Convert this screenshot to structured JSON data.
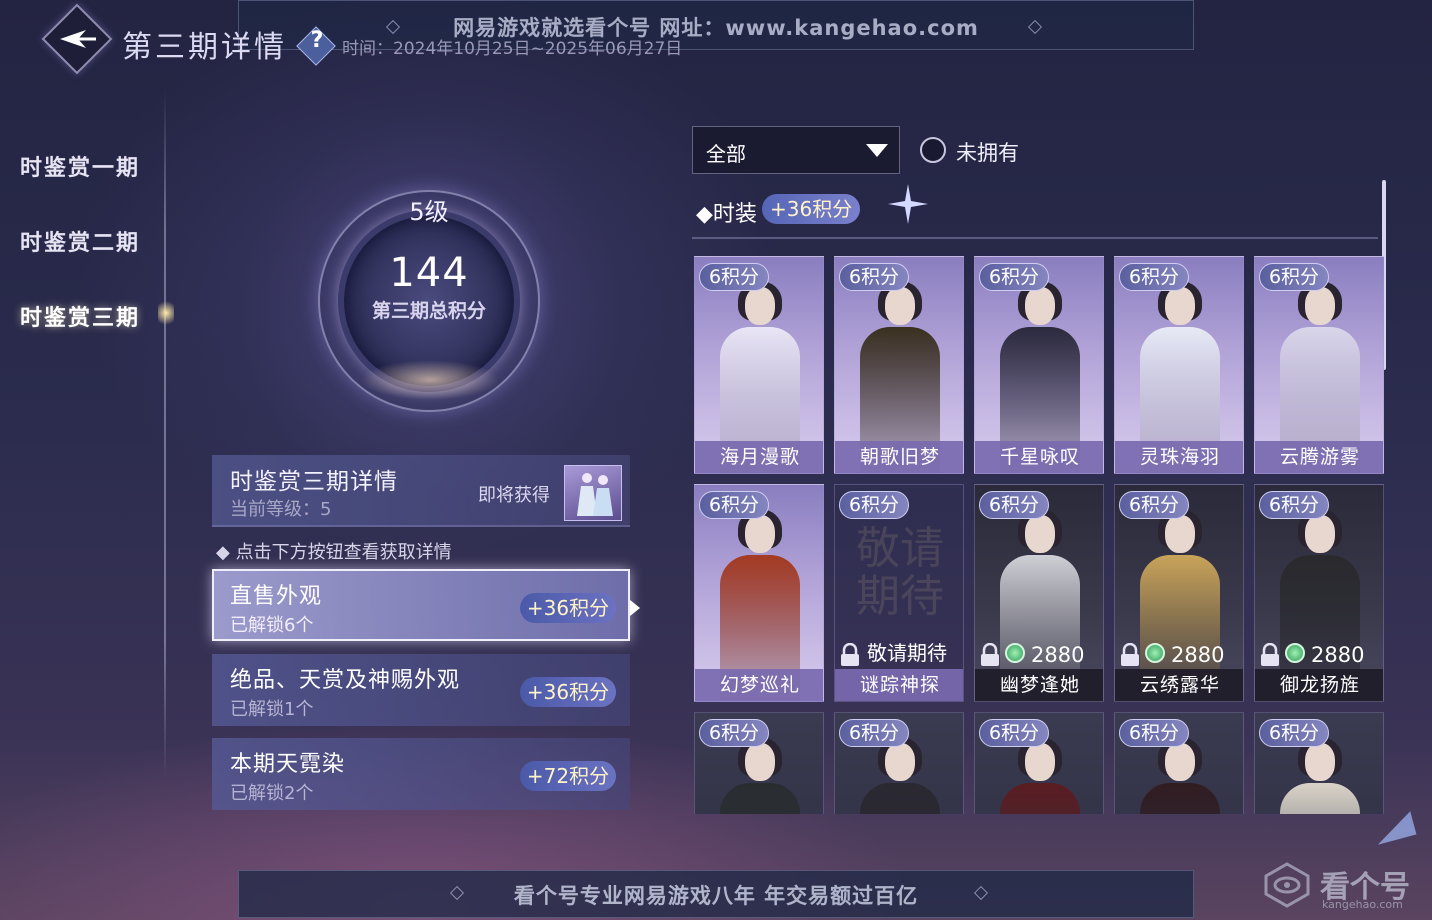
{
  "header": {
    "title": "第三期详情",
    "help_label": "?",
    "date_range": "时间：2024年10月25日~2025年06月27日"
  },
  "watermark": {
    "top": "网易游戏就选看个号   网址：www.kangehao.com",
    "bottom": "看个号专业网易游戏八年   年交易额过百亿",
    "logo": "看个号",
    "logo_sub": "kangehao.com"
  },
  "sidebar": {
    "items": [
      {
        "label": "时鉴赏一期"
      },
      {
        "label": "时鉴赏二期"
      },
      {
        "label": "时鉴赏三期"
      }
    ],
    "active_index": 2
  },
  "emblem": {
    "level": "5级",
    "score": "144",
    "score_label": "第三期总积分"
  },
  "detail": {
    "title": "时鉴赏三期详情",
    "current_level": "当前等级：5",
    "soon_label": "即将获得",
    "hint": "◆ 点击下方按钮查看获取详情"
  },
  "categories": [
    {
      "title": "直售外观",
      "sub": "已解锁6个",
      "points": "+36积分"
    },
    {
      "title": "绝品、天赏及神赐外观",
      "sub": "已解锁1个",
      "points": "+36积分"
    },
    {
      "title": "本期天霓染",
      "sub": "已解锁2个",
      "points": "+72积分"
    }
  ],
  "filter": {
    "dropdown_value": "全部",
    "checkbox_label": "未拥有"
  },
  "section": {
    "label": "◆时装",
    "points": "+36积分"
  },
  "items": [
    {
      "name": "海月漫歌",
      "points": "6积分",
      "state": "owned",
      "color": "#e9e6f6"
    },
    {
      "name": "朝歌旧梦",
      "points": "6积分",
      "state": "owned",
      "color": "#3a3020"
    },
    {
      "name": "千星咏叹",
      "points": "6积分",
      "state": "owned",
      "color": "#2b2a3d"
    },
    {
      "name": "灵珠海羽",
      "points": "6积分",
      "state": "owned",
      "color": "#e7eaf6"
    },
    {
      "name": "云腾游雾",
      "points": "6积分",
      "state": "owned",
      "color": "#d9d6ea"
    },
    {
      "name": "幻梦巡礼",
      "points": "6积分",
      "state": "owned",
      "color": "#a43a22"
    },
    {
      "name": "谜踪神探",
      "points": "6积分",
      "state": "coming",
      "coming_text": "敬请期待",
      "art_text": "敬请期待"
    },
    {
      "name": "幽梦逢她",
      "points": "6积分",
      "state": "locked",
      "price": "2880",
      "color": "#cfcfd6"
    },
    {
      "name": "云绣露华",
      "points": "6积分",
      "state": "locked",
      "price": "2880",
      "color": "#c9a45a"
    },
    {
      "name": "御龙扬旌",
      "points": "6积分",
      "state": "locked",
      "price": "2880",
      "color": "#2a2a2e"
    },
    {
      "name": "",
      "points": "6积分",
      "state": "partial",
      "color": "#2a2d30"
    },
    {
      "name": "",
      "points": "6积分",
      "state": "partial",
      "color": "#2a2830"
    },
    {
      "name": "",
      "points": "6积分",
      "state": "partial",
      "color": "#5a1d22"
    },
    {
      "name": "",
      "points": "6积分",
      "state": "partial",
      "color": "#301d22"
    },
    {
      "name": "",
      "points": "6积分",
      "state": "partial",
      "color": "#d9d3c8"
    }
  ]
}
